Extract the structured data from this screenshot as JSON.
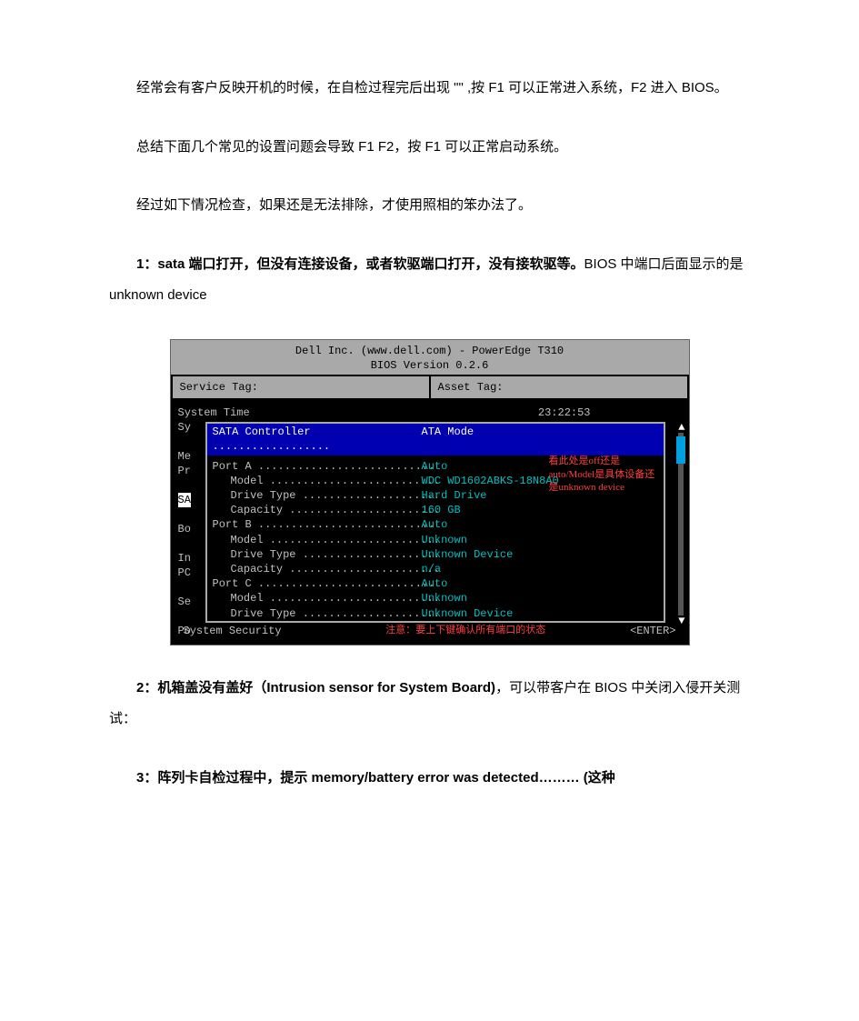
{
  "paragraphs": {
    "p1": "经常会有客户反映开机的时候，在自检过程完后出现 \"\" ,按 F1 可以正常进入系统，F2 进入 BIOS。",
    "p2": "总结下面几个常见的设置问题会导致 F1 F2，按 F1 可以正常启动系统。",
    "p3": "经过如下情况检查，如果还是无法排除，才使用照相的笨办法了。",
    "item1_bold": "1：sata 端口打开，但没有连接设备，或者软驱端口打开，没有接软驱等。",
    "item1_rest": "BIOS 中端口后面显示的是 unknown device",
    "item2_bold": "2：机箱盖没有盖好（Intrusion sensor for System Board)",
    "item2_rest": "，可以带客户在 BIOS 中关闭入侵开关测试：",
    "item3_bold": "3：阵列卡自检过程中，提示 memory/battery error was detected……… (这种"
  },
  "bios": {
    "title1": "Dell Inc. (www.dell.com) - PowerEdge T310",
    "title2": "BIOS Version 0.2.6",
    "service_tag_label": "Service Tag:",
    "asset_tag_label": "Asset Tag:",
    "system_time_label": "System Time",
    "system_time_value": "23:22:53",
    "left_column": [
      "Sy",
      "",
      "Me",
      "Pr",
      "",
      "SA",
      "",
      "Bo",
      "",
      "In",
      "PC",
      "",
      "Se",
      "",
      "Po"
    ],
    "sata_controller_label": "SATA Controller ..................",
    "sata_controller_value": "ATA Mode",
    "rows": [
      {
        "k": "Port A ...........................",
        "v": "Auto",
        "indent": 0,
        "color": "cyan"
      },
      {
        "k": "Model ..........................",
        "v": "WDC WD1602ABKS-18N8A0",
        "indent": 1,
        "color": "cyan"
      },
      {
        "k": "Drive Type .....................",
        "v": "Hard Drive",
        "indent": 1,
        "color": "cyan"
      },
      {
        "k": "Capacity .......................",
        "v": "160 GB",
        "indent": 1,
        "color": "cyan"
      },
      {
        "k": "Port B ...........................",
        "v": "Auto",
        "indent": 0,
        "color": "cyan"
      },
      {
        "k": "Model ..........................",
        "v": "Unknown",
        "indent": 1,
        "color": "cyan"
      },
      {
        "k": "Drive Type .....................",
        "v": "Unknown Device",
        "indent": 1,
        "color": "cyan"
      },
      {
        "k": "Capacity .......................",
        "v": "n/a",
        "indent": 1,
        "color": "cyan"
      },
      {
        "k": "Port C ...........................",
        "v": "Auto",
        "indent": 0,
        "color": "cyan"
      },
      {
        "k": "Model ..........................",
        "v": "Unknown",
        "indent": 1,
        "color": "cyan"
      },
      {
        "k": "Drive Type .....................",
        "v": "Unknown Device",
        "indent": 1,
        "color": "cyan"
      }
    ],
    "annotation": "看此处是off还是auto/Model是具体设备还是unknown device",
    "bottom_label": "System Security",
    "bottom_warn": "注意：要上下键确认所有端口的状态",
    "bottom_enter": "<ENTER>"
  }
}
